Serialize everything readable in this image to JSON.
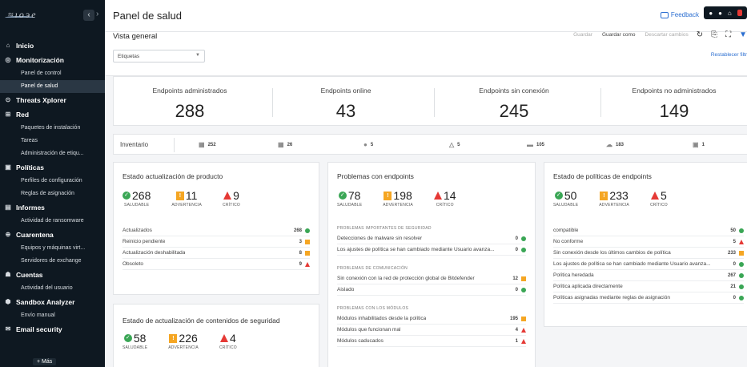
{
  "sidebar": {
    "logo_text": "Bitdefender",
    "more_label": "+ Más",
    "sections": [
      {
        "label": "Inicio",
        "icon": "home-icon",
        "items": []
      },
      {
        "label": "Monitorización",
        "icon": "monitor-icon",
        "items": [
          "Panel de control",
          "Panel de salud"
        ]
      },
      {
        "label": "Threats Xplorer",
        "icon": "threat-icon",
        "items": []
      },
      {
        "label": "Red",
        "icon": "network-icon",
        "items": [
          "Paquetes de instalación",
          "Tareas",
          "Administración de etiqu..."
        ]
      },
      {
        "label": "Políticas",
        "icon": "policy-icon",
        "items": [
          "Perfiles de configuración",
          "Reglas de asignación"
        ]
      },
      {
        "label": "Informes",
        "icon": "report-icon",
        "items": [
          "Actividad de ransomware"
        ]
      },
      {
        "label": "Cuarentena",
        "icon": "quarantine-icon",
        "items": [
          "Equipos y máquinas virt...",
          "Servidores de exchange"
        ]
      },
      {
        "label": "Cuentas",
        "icon": "accounts-icon",
        "items": [
          "Actividad del usuario"
        ]
      },
      {
        "label": "Sandbox Analyzer",
        "icon": "sandbox-icon",
        "items": [
          "Envío manual"
        ]
      },
      {
        "label": "Email security",
        "icon": "email-icon",
        "items": []
      }
    ],
    "active_item": "Panel de salud"
  },
  "header": {
    "title": "Panel de salud",
    "feedback": "Feedback"
  },
  "view": {
    "title": "Vista general",
    "actions": [
      "Guardar",
      "Guardar como",
      "Descartar cambios"
    ],
    "tags_placeholder": "Etiquetas",
    "reset": "Restablecer filtr"
  },
  "metrics": [
    {
      "label": "Endpoints administrados",
      "value": "288"
    },
    {
      "label": "Endpoints online",
      "value": "43"
    },
    {
      "label": "Endpoints sin conexión",
      "value": "245"
    },
    {
      "label": "Endpoints no administrados",
      "value": "149"
    }
  ],
  "inventory": {
    "label": "Inventario",
    "items": [
      {
        "icon": "windows-icon",
        "value": "252"
      },
      {
        "icon": "windows-server-icon",
        "value": "26"
      },
      {
        "icon": "apple-icon",
        "value": "5"
      },
      {
        "icon": "linux-icon",
        "value": "5"
      },
      {
        "icon": "desktop-icon",
        "value": "105"
      },
      {
        "icon": "cloud-icon",
        "value": "183"
      },
      {
        "icon": "tablet-icon",
        "value": "1"
      }
    ]
  },
  "widgets": {
    "product_update": {
      "title": "Estado actualización de producto",
      "summary": {
        "healthy": "268",
        "warning": "11",
        "critical": "9"
      },
      "rows": [
        {
          "label": "Actualizados",
          "value": "268",
          "status": "ok"
        },
        {
          "label": "Reinicio pendiente",
          "value": "3",
          "status": "warn"
        },
        {
          "label": "Actualización deshabilitada",
          "value": "8",
          "status": "warn"
        },
        {
          "label": "Obsoleto",
          "value": "9",
          "status": "crit"
        }
      ]
    },
    "content_update": {
      "title": "Estado de actualización de contenidos de seguridad",
      "summary": {
        "healthy": "58",
        "warning": "226",
        "critical": "4"
      }
    },
    "endpoint_problems": {
      "title": "Problemas con endpoints",
      "summary": {
        "healthy": "78",
        "warning": "198",
        "critical": "14"
      },
      "sections": [
        {
          "header": "PROBLEMAS IMPORTANTES DE SEGURIDAD",
          "rows": [
            {
              "label": "Detecciones de malware sin resolver",
              "value": "0",
              "status": "ok"
            },
            {
              "label": "Los ajustes de política se han cambiado mediante Usuario avanza...",
              "value": "0",
              "status": "ok"
            }
          ]
        },
        {
          "header": "PROBLEMAS DE COMUNICACIÓN",
          "rows": [
            {
              "label": "Sin conexión con la red de protección global de Bitdefender",
              "value": "12",
              "status": "warn"
            },
            {
              "label": "Aislado",
              "value": "0",
              "status": "ok"
            }
          ]
        },
        {
          "header": "PROBLEMAS CON LOS MÓDULOS",
          "rows": [
            {
              "label": "Módulos inhabilitados desde la política",
              "value": "195",
              "status": "warn"
            },
            {
              "label": "Módulos que funcionan mal",
              "value": "4",
              "status": "crit"
            },
            {
              "label": "Módulos caducados",
              "value": "1",
              "status": "crit"
            }
          ]
        }
      ]
    },
    "policy_status": {
      "title": "Estado de políticas de endpoints",
      "summary": {
        "healthy": "50",
        "warning": "233",
        "critical": "5"
      },
      "rows": [
        {
          "label": "compatible",
          "value": "50",
          "status": "ok"
        },
        {
          "label": "No conforme",
          "value": "5",
          "status": "crit"
        },
        {
          "label": "Sin conexión desde los últimos cambios de política",
          "value": "233",
          "status": "warn"
        },
        {
          "label": "Los ajustes de política se han cambiado mediante Usuario avanza...",
          "value": "0",
          "status": "ok"
        },
        {
          "label": "Política heredada",
          "value": "267",
          "status": "ok"
        },
        {
          "label": "Política aplicada directamente",
          "value": "21",
          "status": "ok"
        },
        {
          "label": "Políticas asignadas mediante reglas de asignación",
          "value": "0",
          "status": "ok"
        }
      ]
    }
  },
  "captions": {
    "healthy": "SALUDABLE",
    "warning": "ADVERTENCIA",
    "critical": "CRÍTICO"
  },
  "colors": {
    "ok": "#3aa655",
    "warn": "#f5a623",
    "crit": "#e53935",
    "accent": "#2c6fd1",
    "sidebar": "#0e1821"
  }
}
